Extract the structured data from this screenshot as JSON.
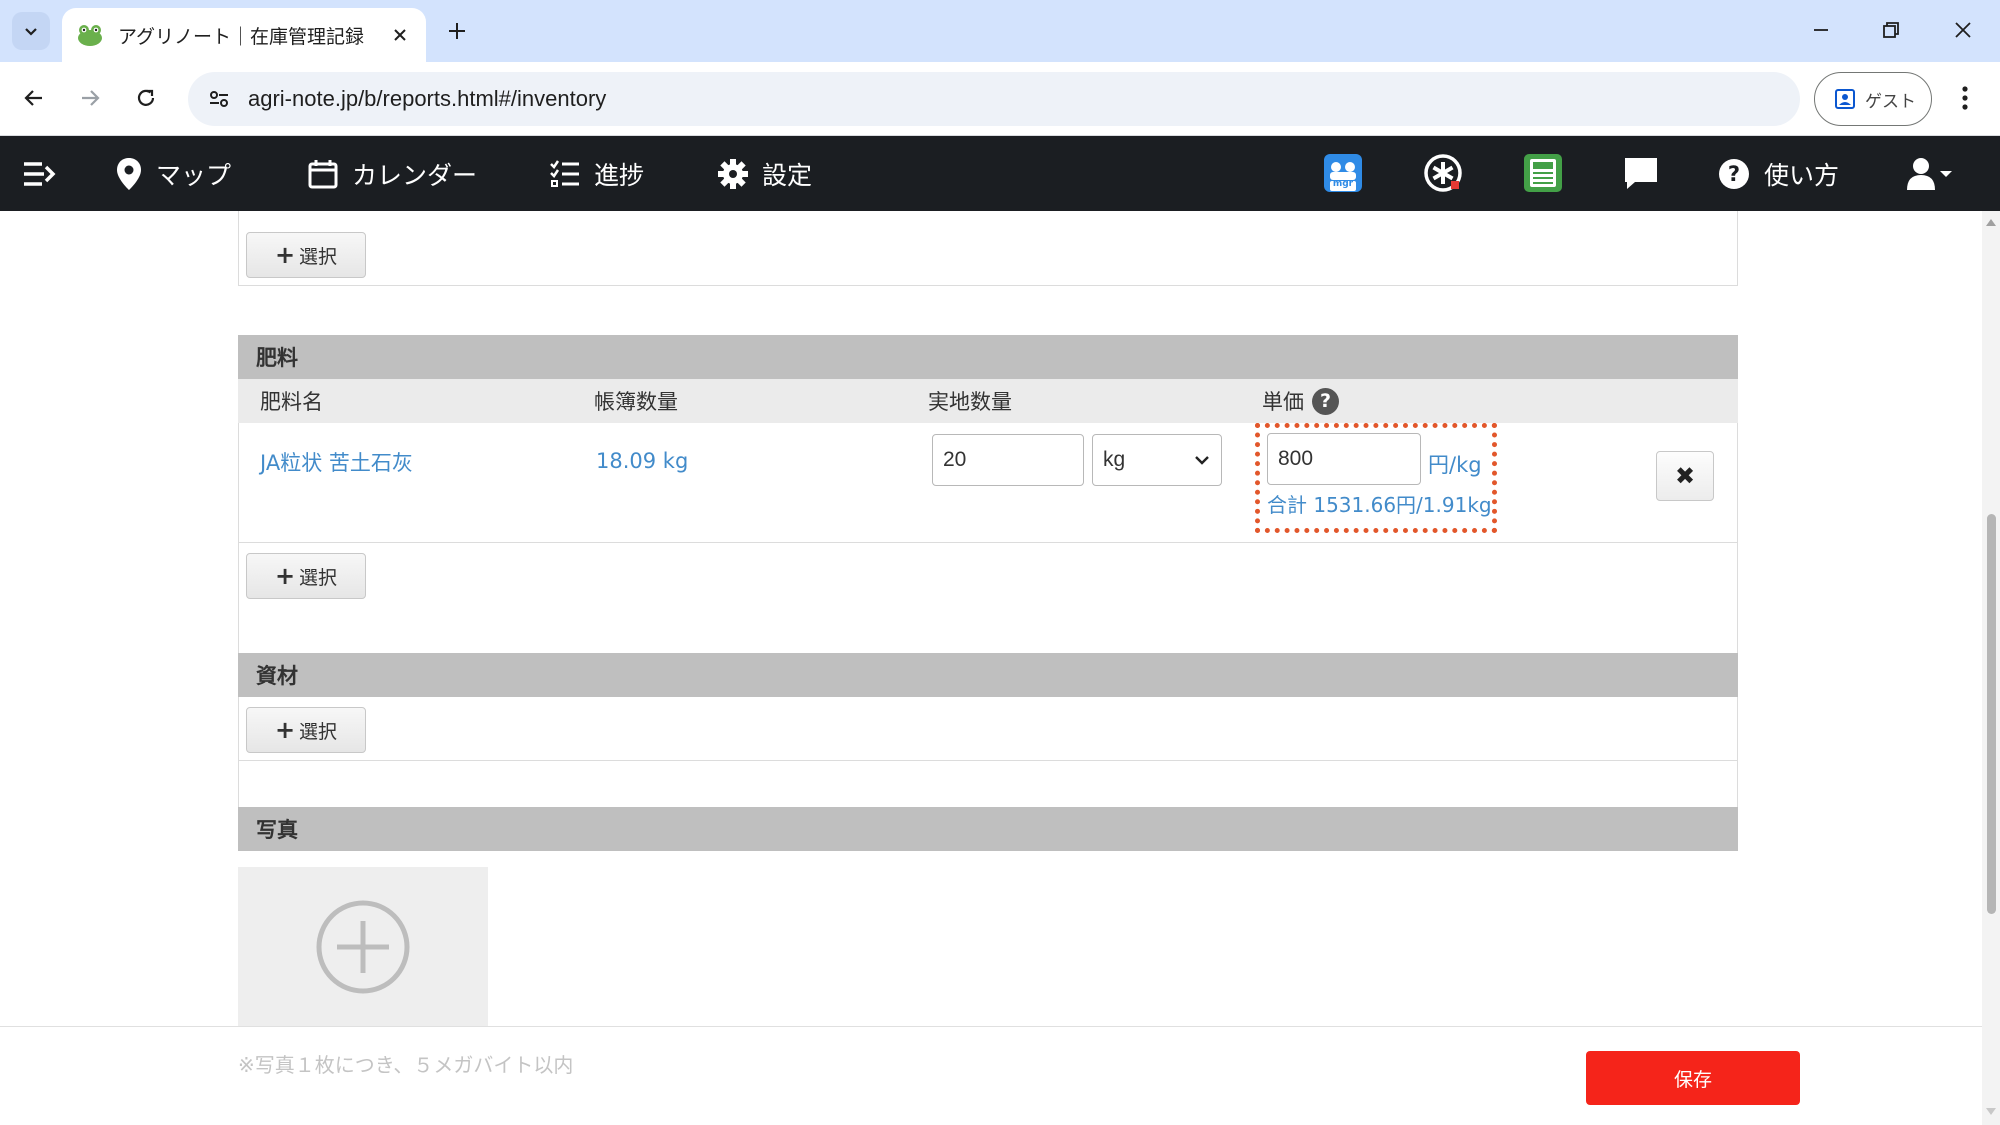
{
  "browser": {
    "tab_title": "アグリノート｜在庫管理記録",
    "url": "agri-note.jp/b/reports.html#/inventory",
    "profile_label": "ゲスト"
  },
  "appnav": {
    "map": "マップ",
    "calendar": "カレンダー",
    "progress": "進捗",
    "settings": "設定",
    "help": "使い方",
    "mgr_badge": "mgr"
  },
  "sections": {
    "prev_select_label": "選択",
    "fertilizer": {
      "title": "肥料",
      "columns": {
        "name": "肥料名",
        "book_qty": "帳簿数量",
        "actual_qty": "実地数量",
        "unit_price": "単価"
      },
      "row": {
        "name": "JA粒状 苦土石灰",
        "book_qty": "18.09 kg",
        "actual_qty_value": "20",
        "unit_value": "kg",
        "unit_price_value": "800",
        "price_unit": "円/kg",
        "total": "合計 1531.66円/1.91kg"
      },
      "select_label": "選択"
    },
    "materials": {
      "title": "資材",
      "select_label": "選択"
    },
    "photo": {
      "title": "写真"
    }
  },
  "footer": {
    "note": "※写真１枚につき、５メガバイト以内",
    "save_label": "保存"
  },
  "colors": {
    "nav_bg": "#1b1e22",
    "link_blue": "#428bca",
    "save_red": "#f5241a",
    "highlight": "#e2572b"
  }
}
